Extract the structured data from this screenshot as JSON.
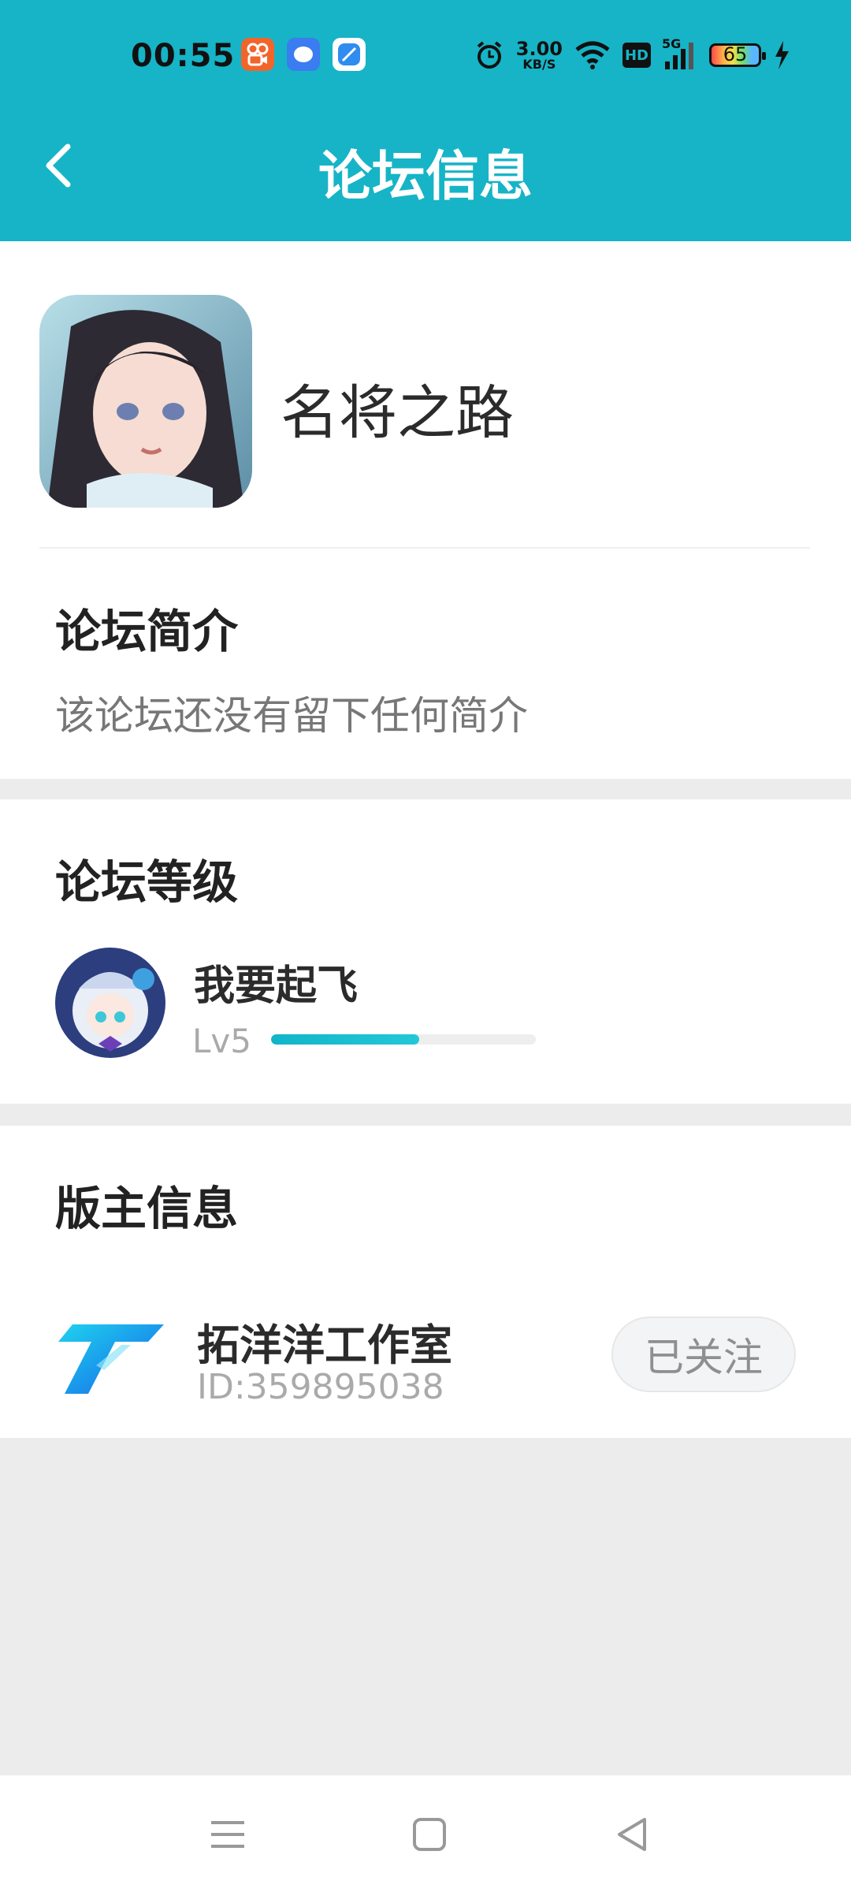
{
  "status_bar": {
    "time": "00:55",
    "speed_value": "3.00",
    "speed_unit": "KB/S",
    "network": "5G",
    "hd": "HD",
    "battery": "65",
    "icons": [
      "kuaishou-app-icon",
      "chat-bubble-app-icon",
      "browser-app-icon",
      "alarm-icon",
      "wifi-icon",
      "signal-icon",
      "charging-icon"
    ]
  },
  "header": {
    "title": "论坛信息",
    "back_icon": "chevron-left-icon"
  },
  "forum": {
    "name": "名将之路",
    "icon": "forum-game-icon"
  },
  "intro": {
    "title": "论坛简介",
    "text": "该论坛还没有留下任何简介"
  },
  "level": {
    "title": "论坛等级",
    "user_name": "我要起飞",
    "level_label": "Lv5",
    "progress": 0.56
  },
  "moderator": {
    "title": "版主信息",
    "name": "拓洋洋工作室",
    "id": "ID:359895038",
    "follow_label": "已关注"
  },
  "colors": {
    "accent": "#16b4c6",
    "background": "#ececec",
    "follow_button_bg": "#f3f4f5"
  },
  "nav_bar": {
    "icons": [
      "menu-icon",
      "home-square-icon",
      "back-triangle-icon"
    ]
  }
}
